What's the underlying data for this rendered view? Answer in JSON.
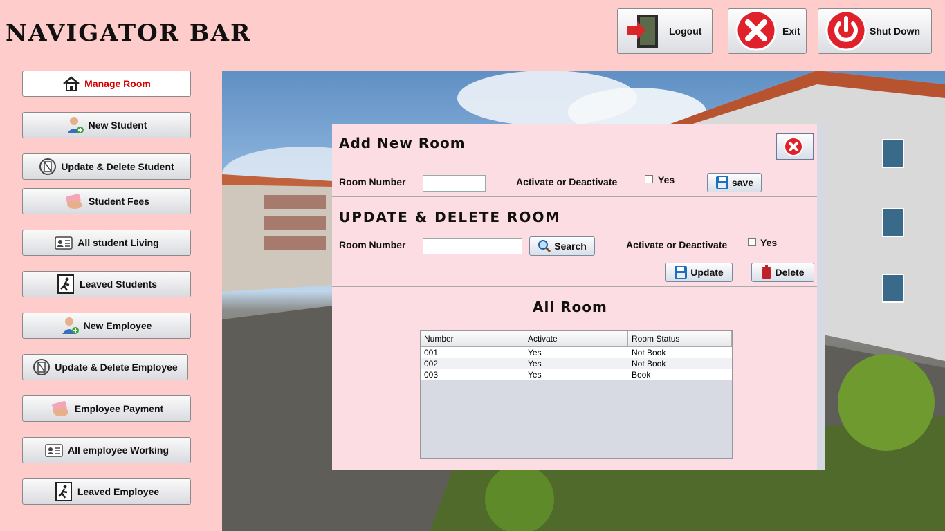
{
  "app": {
    "title": "NAVIGATOR BAR"
  },
  "top_buttons": {
    "logout": "Logout",
    "exit": "Exit",
    "shutdown": "Shut Down"
  },
  "sidebar": {
    "items": [
      {
        "label": "Manage Room",
        "icon": "home-icon"
      },
      {
        "label": "New Student",
        "icon": "user-add-icon"
      },
      {
        "label": "Update & Delete Student",
        "icon": "edit-icon"
      },
      {
        "label": "Student Fees",
        "icon": "money-icon"
      },
      {
        "label": "All student Living",
        "icon": "id-card-icon"
      },
      {
        "label": "Leaved Students",
        "icon": "exit-door-icon"
      },
      {
        "label": "New Employee",
        "icon": "user-add-icon"
      },
      {
        "label": "Update & Delete Employee",
        "icon": "edit-icon"
      },
      {
        "label": "Employee Payment",
        "icon": "money-icon"
      },
      {
        "label": "All employee Working",
        "icon": "id-card-icon"
      },
      {
        "label": "Leaved Employee",
        "icon": "exit-door-icon"
      }
    ]
  },
  "add_room": {
    "heading": "Add New Room",
    "room_number_label": "Room Number",
    "room_number_value": "",
    "activate_label": "Activate or Deactivate",
    "yes_label": "Yes",
    "save_label": "save"
  },
  "update_room": {
    "heading": "UPDATE & DELETE ROOM",
    "room_number_label": "Room Number",
    "room_number_value": "",
    "search_label": "Search",
    "activate_label": "Activate or Deactivate",
    "yes_label": "Yes",
    "update_label": "Update",
    "delete_label": "Delete"
  },
  "all_room": {
    "heading": "All Room",
    "columns": [
      "Number",
      "Activate",
      "Room Status"
    ],
    "rows": [
      [
        "001",
        "Yes",
        "Not Book"
      ],
      [
        "002",
        "Yes",
        "Not Book"
      ],
      [
        "003",
        "Yes",
        "Book"
      ]
    ]
  },
  "colors": {
    "background": "#ffcccc",
    "panel": "#fddde4",
    "active_text": "#d40000",
    "exit_red": "#e0202a"
  }
}
